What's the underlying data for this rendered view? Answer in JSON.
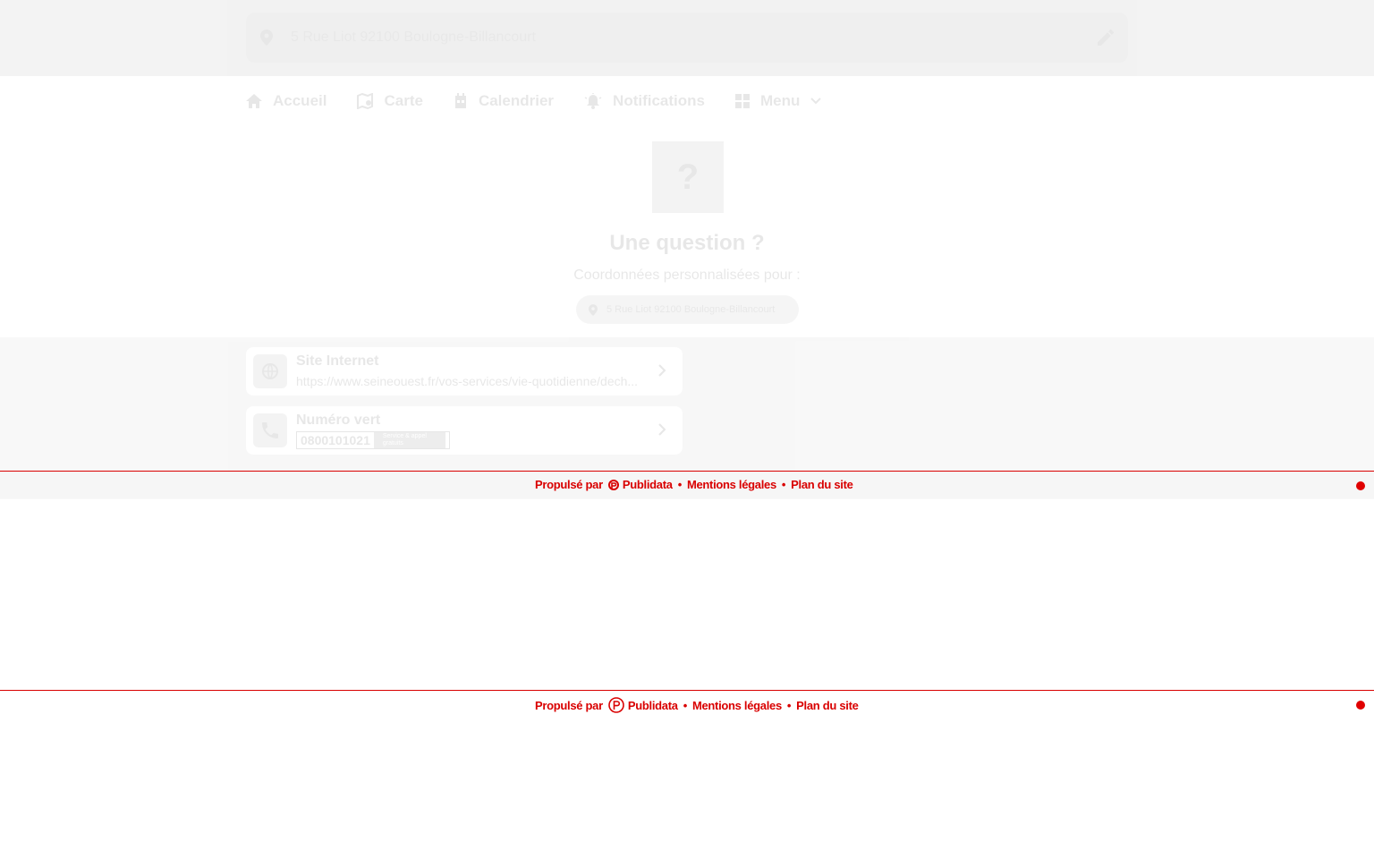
{
  "address_bar": {
    "address": "5 Rue Liot 92100 Boulogne-Billancourt"
  },
  "nav": {
    "items": [
      {
        "label": "Accueil",
        "icon": "home-icon"
      },
      {
        "label": "Carte",
        "icon": "map-icon"
      },
      {
        "label": "Calendrier",
        "icon": "calendar-icon"
      },
      {
        "label": "Notifications",
        "icon": "bell-icon"
      },
      {
        "label": "Menu",
        "icon": "grid-icon"
      }
    ]
  },
  "hero": {
    "icon_glyph": "?",
    "title": "Une question ?",
    "subtitle": "Coordonnées personnalisées pour :",
    "address": "5 Rue Liot 92100 Boulogne-Billancourt"
  },
  "contacts": [
    {
      "title": "Site Internet",
      "value": "https://www.seineouest.fr/vos-services/vie-quotidienne/dech...",
      "icon": "globe-icon"
    },
    {
      "title": "Numéro vert",
      "value": "0800101021",
      "badge": "Service & appel gratuits",
      "icon": "phone-icon"
    }
  ],
  "footer": {
    "powered_by": "Propulsé par",
    "brand": "Publidata",
    "legal": "Mentions légales",
    "sitemap": "Plan du site",
    "separator": "•"
  },
  "colors": {
    "footer_red": "#d90000",
    "dot_red": "#e00000"
  }
}
